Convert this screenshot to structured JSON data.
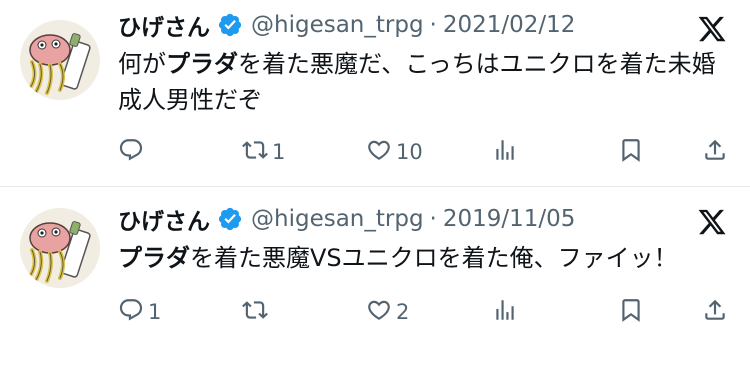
{
  "tweets": [
    {
      "display_name": "ひげさん",
      "handle": "@higesan_trpg",
      "separator": "·",
      "date": "2021/02/12",
      "text_parts": [
        {
          "t": "何が",
          "bold": false
        },
        {
          "t": "プラダ",
          "bold": true
        },
        {
          "t": "を着た悪魔だ、こっちはユニクロを着た未婚成人男性だぞ",
          "bold": false
        }
      ],
      "reply_count": "",
      "retweet_count": "1",
      "like_count": "10"
    },
    {
      "display_name": "ひげさん",
      "handle": "@higesan_trpg",
      "separator": "·",
      "date": "2019/11/05",
      "text_parts": [
        {
          "t": "プラダ",
          "bold": true
        },
        {
          "t": "を着た悪魔VSユニクロを着た俺、ファイッ！",
          "bold": false
        }
      ],
      "reply_count": "1",
      "retweet_count": "",
      "like_count": "2"
    }
  ],
  "colors": {
    "text": "#0f1419",
    "secondary": "#536471",
    "verified": "#1d9bf0",
    "divider": "#e7e9ea"
  },
  "icons": [
    "verified-badge-icon",
    "x-logo-icon",
    "reply-icon",
    "retweet-icon",
    "like-icon",
    "views-icon",
    "bookmark-icon",
    "share-icon"
  ]
}
